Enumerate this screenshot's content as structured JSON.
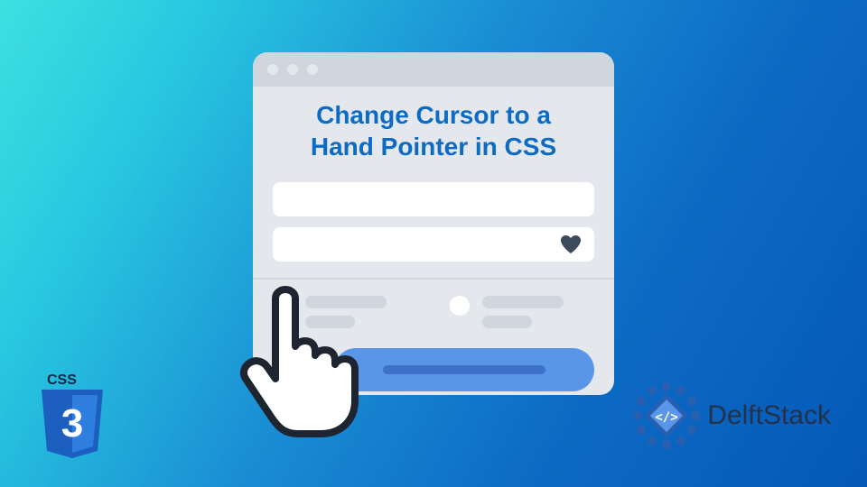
{
  "title_line1": "Change Cursor to a",
  "title_line2": "Hand Pointer in CSS",
  "css_badge_label": "CSS",
  "css_badge_number": "3",
  "brand_name": "DelftStack",
  "colors": {
    "accent_blue": "#0d6bc4",
    "button_blue": "#5a96e8",
    "window_bg": "#e4e8ed"
  }
}
